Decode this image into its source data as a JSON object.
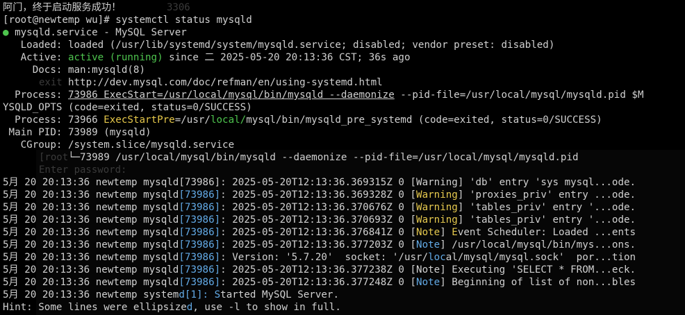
{
  "lines": {
    "l1": "阿门，终于启动服务成功！",
    "l2": "[root@newtemp wu]# systemctl status mysqld",
    "l3_dot": "●",
    "l3": " mysqld.service - MySQL Server",
    "l4": "   Loaded: loaded (/usr/lib/systemd/system/mysqld.service; disabled; vendor preset: disabled)",
    "l5_a": "   Active: ",
    "l5_b": "active (running)",
    "l5_c": " since 二 2025-05-20 20:13:36 CST; 36s ago",
    "l6": "     Docs: man:mysqld(8)",
    "l7": "           http://dev.mysql.com/doc/refman/en/using-systemd.html",
    "l8_a": "  Process: ",
    "l8_b": "73986 ExecStart=/usr/local/mysql/bin/mysqld --daemonize",
    "l8_c": " --pid-file=/usr/local/mysql/mysqld.pid $M",
    "l9": "YSQLD_OPTS (code=exited, status=0/SUCCESS)",
    "l10_a": "  Process: 73966 ",
    "l10_b": "ExecStartPre",
    "l10_c": "=/usr/",
    "l10_d": "local/",
    "l10_e": "mysql/bin/mysqld_pre_systemd (code=exited, status=0/SUCCESS)",
    "l11": " Main PID: 73989 (mysqld)",
    "l12": "   CGroup: /system.slice/mysqld.service",
    "l13": "           └─73989 /usr/local/mysql/bin/mysqld --daemonize --pid-file=/usr/local/mysql/mysqld.pid",
    "l14": "",
    "log_prefix": "5月 20 20:13:36 newtemp mysqld",
    "log1_pid": "[73986]",
    "log1_rest": ": 2025-05-20T12:13:36.369315Z 0 [Warning] 'db' entry 'sys mysql...ode.",
    "log2_pid": "[73986]",
    "log2_a": ": 2025-05-20T12:13:36.369328Z 0 [",
    "log2_tag": "Warning",
    "log2_b": "] 'proxies_priv' entry ...ode.",
    "log3_pid": "[73986]",
    "log3_a": ": 2025-05-20T12:13:36.370676Z 0 [",
    "log3_tag": "Warning",
    "log3_b": "] 'tables_priv' entry '...ode.",
    "log4_pid": "[73986]",
    "log4_a": ": 2025-05-20T12:13:36.370693Z 0 [",
    "log4_tag": "Warning",
    "log4_b": "] 'tables_priv' entry '...ode.",
    "log5_pid": "[73986]",
    "log5_a": ": 2025-05-20T12:13:36.376841Z 0 [",
    "log5_tag": "Note",
    "log5_b": "] ",
    "log5_e": "E",
    "log5_c": "vent Scheduler: Loaded ...ents",
    "log6_pid": "[73986]",
    "log6_a": ": 2025-05-20T12:13:36.377203Z 0 [",
    "log6_tag": "Note",
    "log6_b": "] /usr/local/mysql/bin/mys...ons.",
    "log7_pid": "[73986]",
    "log7_a": ": Version: '5.7.20'  socket: '/usr/",
    "log7_b": "loc",
    "log7_c": "al/mysql/mysql.sock'  por...tion",
    "log8_pid": "[73986]",
    "log8_rest": ": 2025-05-20T12:13:36.377238Z 0 [Note] Executing 'SELECT * FROM...eck.",
    "log9_pid": "[73986]",
    "log9_a": ": 2025-05-20T12:13:36.377248Z 0 [",
    "log9_tag": "Note",
    "log9_b": "] Beginning of list of non...bles",
    "log10_a": "5月 20 20:13:36 newtemp system",
    "log10_b": "d[1]: S",
    "log10_c": "tarted MySQL Server.",
    "hint_a": "Hint: Some lines were ellipsize",
    "hint_b": "d",
    "hint_c": ", use -l to show in full."
  },
  "ghost": {
    "g1": "3306",
    "g2": "exit",
    "g3": "[root",
    "g4": "Enter password:"
  },
  "colors": {
    "background": "#000000",
    "text": "#d0d0d0",
    "green": "#4ec44e",
    "yellow": "#e6c84a",
    "blue": "#5fa8e6"
  }
}
